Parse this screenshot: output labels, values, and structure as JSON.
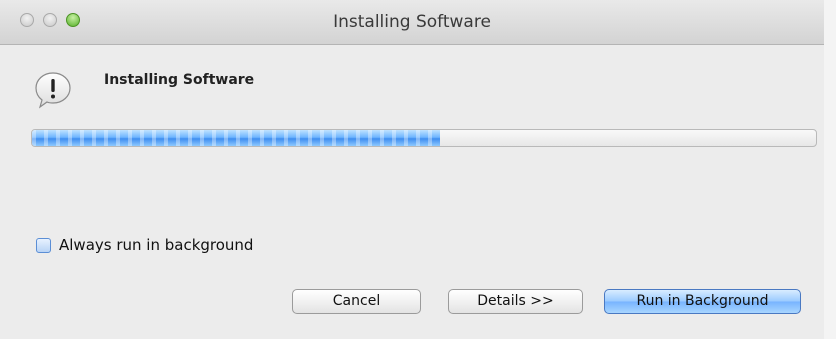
{
  "window": {
    "title": "Installing Software"
  },
  "dialog": {
    "heading": "Installing Software",
    "progress_percent": 52,
    "checkbox_label": "Always run in background",
    "checkbox_checked": false
  },
  "buttons": {
    "cancel_label": "Cancel",
    "details_label": "Details >>",
    "run_background_label": "Run in Background"
  },
  "icons": {
    "close": "close-traffic-light",
    "minimize": "minimize-traffic-light",
    "zoom": "zoom-traffic-light",
    "alert": "alert-icon"
  },
  "colors": {
    "accent": "#3f8ef0",
    "zoom_green": "#57b12a"
  }
}
